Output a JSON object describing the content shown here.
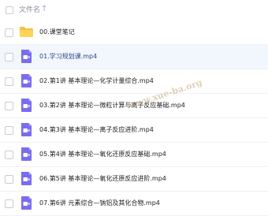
{
  "header": {
    "label": "文件名",
    "sort_icon": "sort-arrow-up-icon",
    "sort_glyph": "↑"
  },
  "colors": {
    "folder": "#f5c242",
    "video": "#7a6cf0",
    "selected_bg": "#f2f6fd",
    "selected_text": "#2b4a8b"
  },
  "files": [
    {
      "name": "00.课堂笔记",
      "type": "folder",
      "icon": "folder-icon",
      "selected": false
    },
    {
      "name": "01.学习规划课.mp4",
      "type": "video",
      "icon": "video-file-icon",
      "selected": true
    },
    {
      "name": "02.第1讲 基本理论—化学计量综合.mp4",
      "type": "video",
      "icon": "video-file-icon",
      "selected": false
    },
    {
      "name": "03.第2讲 基本理论—微粒计算与离子反应基础.mp4",
      "type": "video",
      "icon": "video-file-icon",
      "selected": false
    },
    {
      "name": "04.第3讲 基本理论—离子反应进阶.mp4",
      "type": "video",
      "icon": "video-file-icon",
      "selected": false
    },
    {
      "name": "05.第4讲 基本理论—氧化还原反应基础.mp4",
      "type": "video",
      "icon": "video-file-icon",
      "selected": false
    },
    {
      "name": "06.第5讲 基本理论—氧化还原反应进阶.mp4",
      "type": "video",
      "icon": "video-file-icon",
      "selected": false
    },
    {
      "name": "07.第6讲 元素综合—钠铝及其化合物.mp4",
      "type": "video",
      "icon": "video-file-icon",
      "selected": false
    }
  ],
  "watermark": "www.xue-ba.org"
}
